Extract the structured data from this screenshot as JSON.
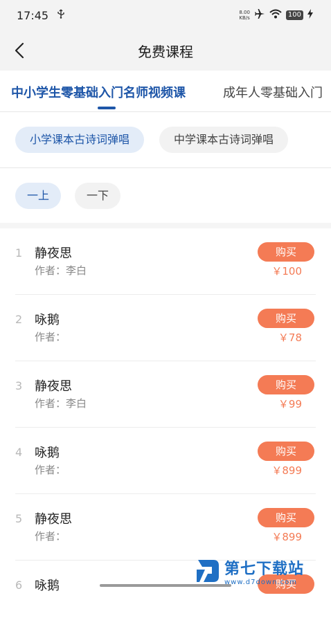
{
  "status_bar": {
    "time": "17:45",
    "usb_icon": "usb-icon",
    "net_speed_value": "8.00",
    "net_speed_unit": "KB/s",
    "battery": "100"
  },
  "nav": {
    "title": "免费课程",
    "back_icon": "chevron-left-icon"
  },
  "tabs": [
    {
      "label": "中小学生零基础入门名师视频课",
      "active": true
    },
    {
      "label": "成年人零基础入门",
      "active": false
    }
  ],
  "categories": [
    {
      "label": "小学课本古诗词弹唱",
      "selected": true
    },
    {
      "label": "中学课本古诗词弹唱",
      "selected": false
    }
  ],
  "grades": [
    {
      "label": "一上",
      "selected": true
    },
    {
      "label": "一下",
      "selected": false
    }
  ],
  "author_prefix": "作者：",
  "buy_label": "购买",
  "courses": [
    {
      "index": "1",
      "title": "静夜思",
      "author": "作者：李白",
      "price": "￥100"
    },
    {
      "index": "2",
      "title": "咏鹅",
      "author": "作者：",
      "price": "￥78"
    },
    {
      "index": "3",
      "title": "静夜思",
      "author": "作者：李白",
      "price": "￥99"
    },
    {
      "index": "4",
      "title": "咏鹅",
      "author": "作者：",
      "price": "￥899"
    },
    {
      "index": "5",
      "title": "静夜思",
      "author": "作者：",
      "price": "￥899"
    },
    {
      "index": "6",
      "title": "咏鹅",
      "author": "",
      "price": ""
    }
  ],
  "watermark": {
    "name": "第七下载站",
    "url": "www.d7down.com"
  },
  "colors": {
    "accent": "#1e56a8",
    "buy": "#f47b55",
    "chip_selected_bg": "#e3ecf8"
  }
}
